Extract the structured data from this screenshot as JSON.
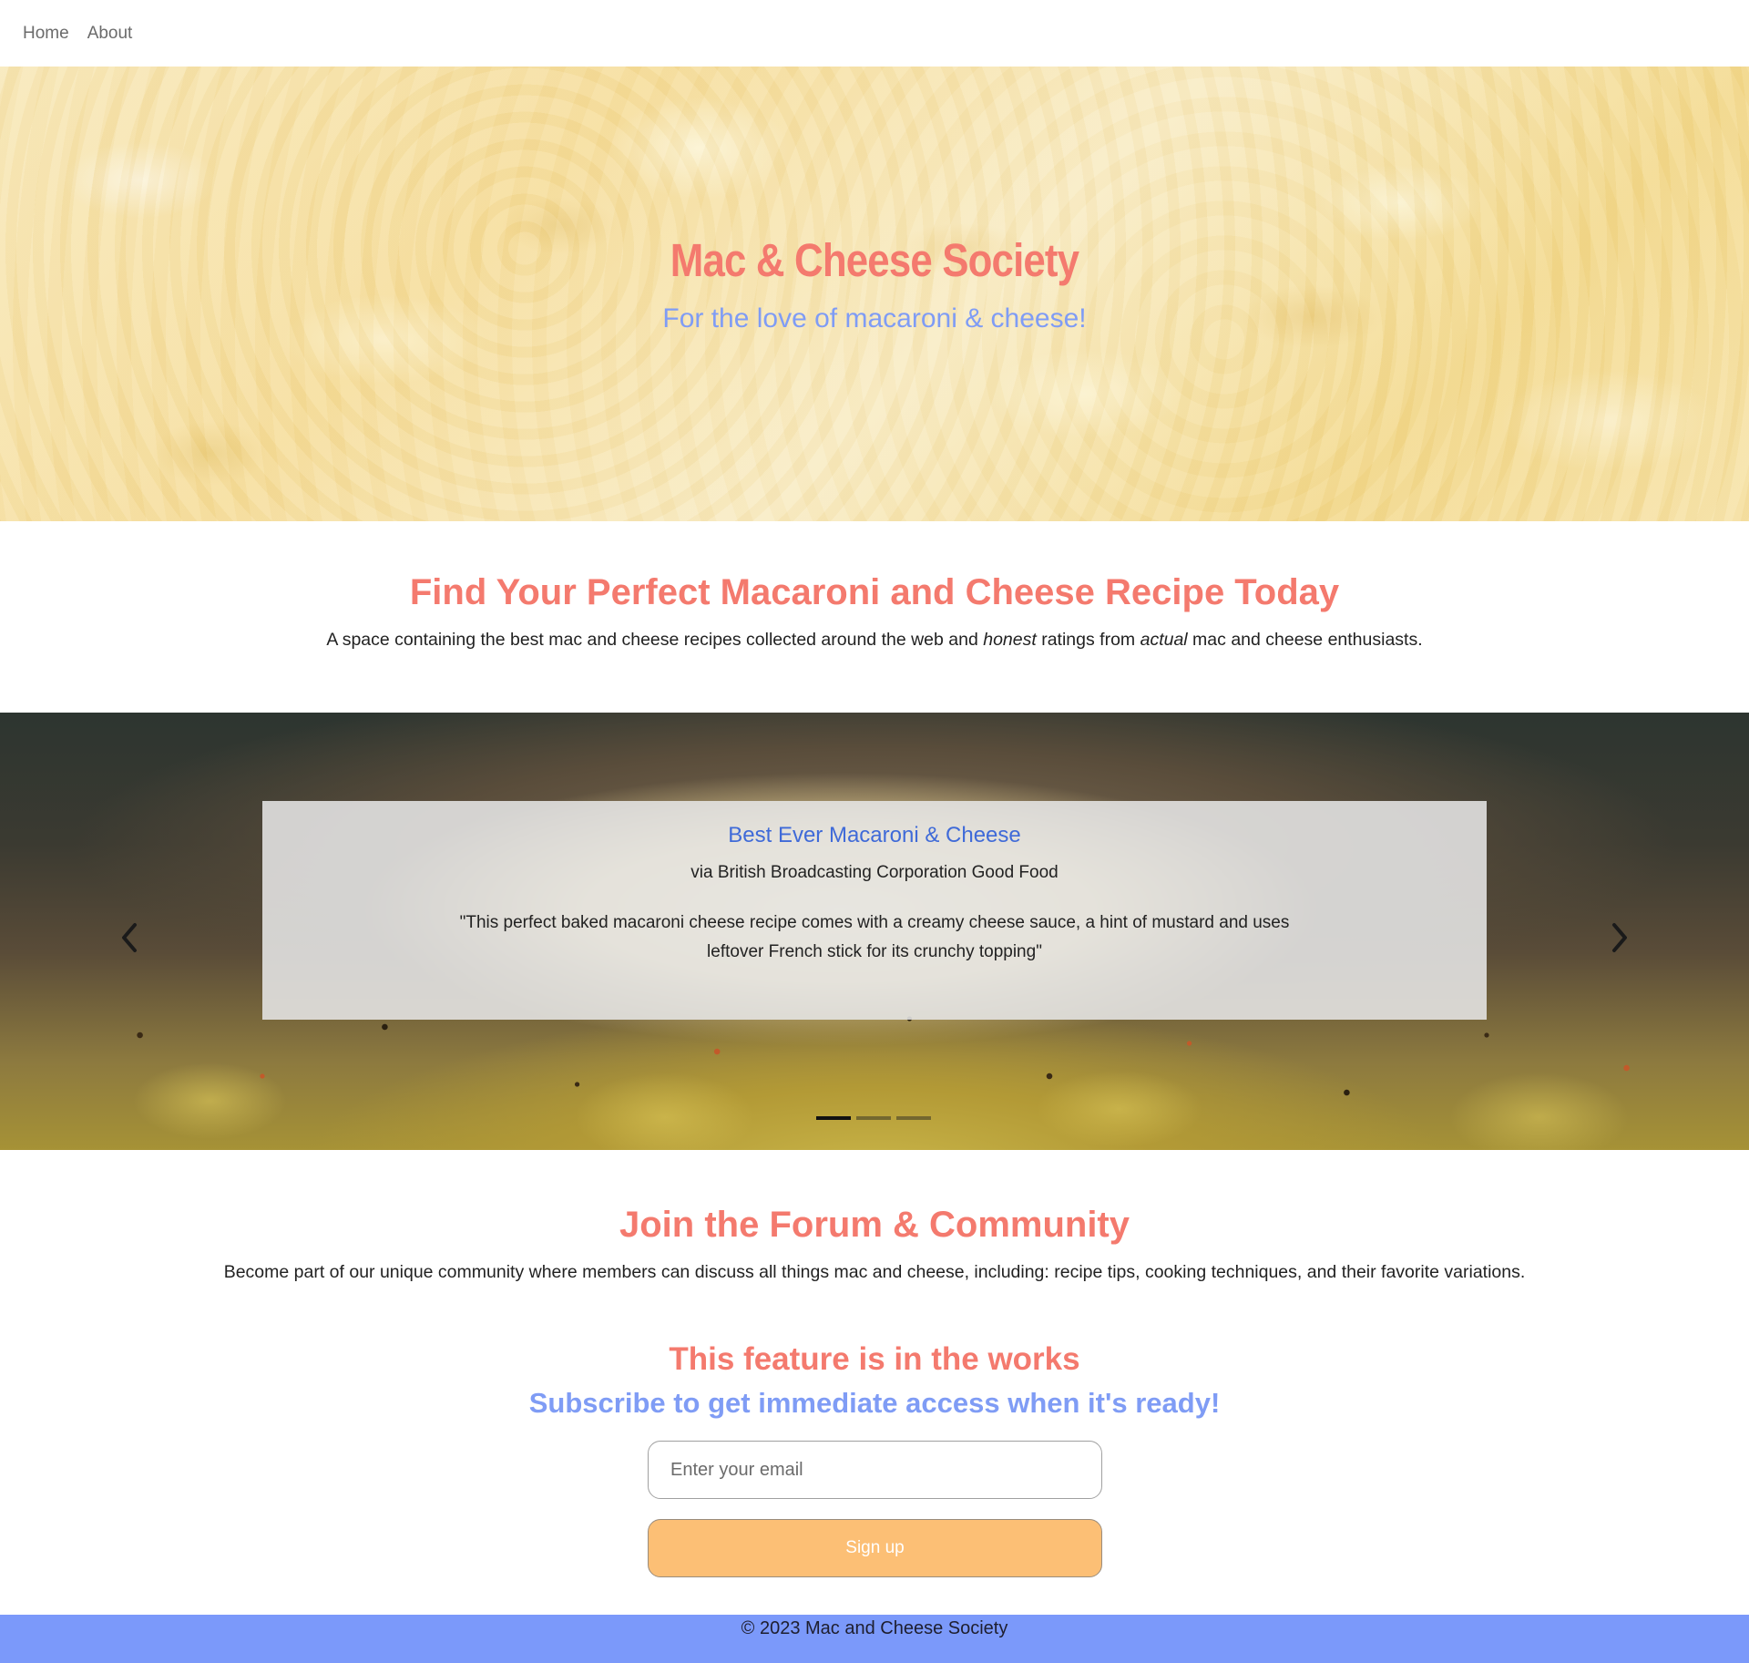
{
  "nav": {
    "items": [
      {
        "label": "Home"
      },
      {
        "label": "About"
      }
    ]
  },
  "hero": {
    "title": "Mac & Cheese Society",
    "subtitle": "For the love of macaroni & cheese!"
  },
  "intro": {
    "heading": "Find Your Perfect Macaroni and Cheese Recipe Today",
    "text_before": "A space containing the best mac and cheese recipes collected around the web and ",
    "emph1": "honest",
    "text_middle": " ratings from ",
    "emph2": "actual",
    "text_after": " mac and cheese enthusiasts."
  },
  "carousel": {
    "slide_title": "Best Ever Macaroni & Cheese",
    "slide_source": "via British Broadcasting Corporation Good Food",
    "slide_quote": "\"This perfect baked macaroni cheese recipe comes with a creamy cheese sauce, a hint of mustard and uses leftover French stick for its crunchy topping\"",
    "prev_icon": "chevron-left-icon",
    "next_icon": "chevron-right-icon",
    "slide_count": 3,
    "active_slide": 1
  },
  "forum": {
    "heading": "Join the Forum & Community",
    "text": "Become part of our unique community where members can discuss all things mac and cheese, including: recipe tips, cooking techniques, and their favorite variations.",
    "works_heading": "This feature is in the works",
    "subscribe_heading": "Subscribe to get immediate access when it's ready!",
    "email_placeholder": "Enter your email",
    "email_value": "",
    "signup_label": "Sign up"
  },
  "footer": {
    "text": "© 2023 Mac and Cheese Society"
  },
  "colors": {
    "accent_coral": "#f47a6e",
    "accent_blue": "#7f9cf5",
    "link_blue": "#3f6ad8",
    "button_orange": "#fcbf75",
    "footer_blue": "#7b99fa"
  }
}
